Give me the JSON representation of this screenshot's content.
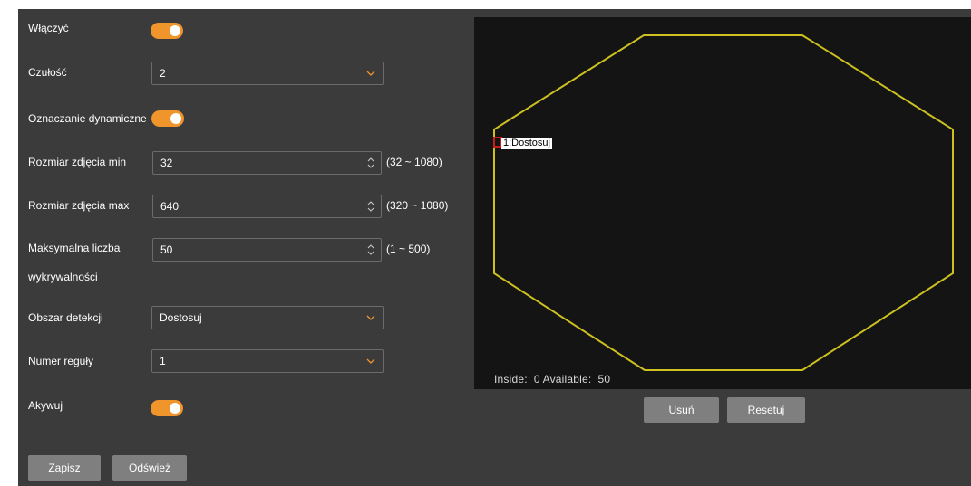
{
  "form": {
    "enable": {
      "label": "Włączyć",
      "value": true
    },
    "sensitivity": {
      "label": "Czułość",
      "value": "2"
    },
    "dynamic_marking": {
      "label": "Oznaczanie dynamiczne",
      "value": true
    },
    "min_size": {
      "label": "Rozmiar zdjęcia min",
      "value": "32",
      "range": "(32 ~ 1080)"
    },
    "max_size": {
      "label": "Rozmiar zdjęcia max",
      "value": "640",
      "range": "(320 ~ 1080)"
    },
    "max_detections": {
      "label_line1": "Maksymalna liczba",
      "label_line2": "wykrywalności",
      "value": "50",
      "range": "(1 ~ 500)"
    },
    "detection_area": {
      "label": "Obszar detekcji",
      "value": "Dostosuj"
    },
    "rule_number": {
      "label": "Numer reguły",
      "value": "1"
    },
    "activate": {
      "label": "Akywuj",
      "value": true
    }
  },
  "buttons": {
    "save": "Zapisz",
    "refresh": "Odśwież",
    "delete": "Usuń",
    "reset": "Resetuj"
  },
  "preview": {
    "region_label": "1:Dostosuj",
    "status_inside_label": "Inside:",
    "status_inside_value": "0",
    "status_available_label": "Available:",
    "status_available_value": "50"
  },
  "colors": {
    "accent": "#f0942c",
    "panel_bg": "#3b3b3b",
    "preview_bg": "#141414",
    "polygon": "#cdc11f",
    "marker": "#c81b1b"
  },
  "icons": {
    "dropdown": "chevron-down-icon",
    "spinner": "spin-arrows-icon"
  }
}
